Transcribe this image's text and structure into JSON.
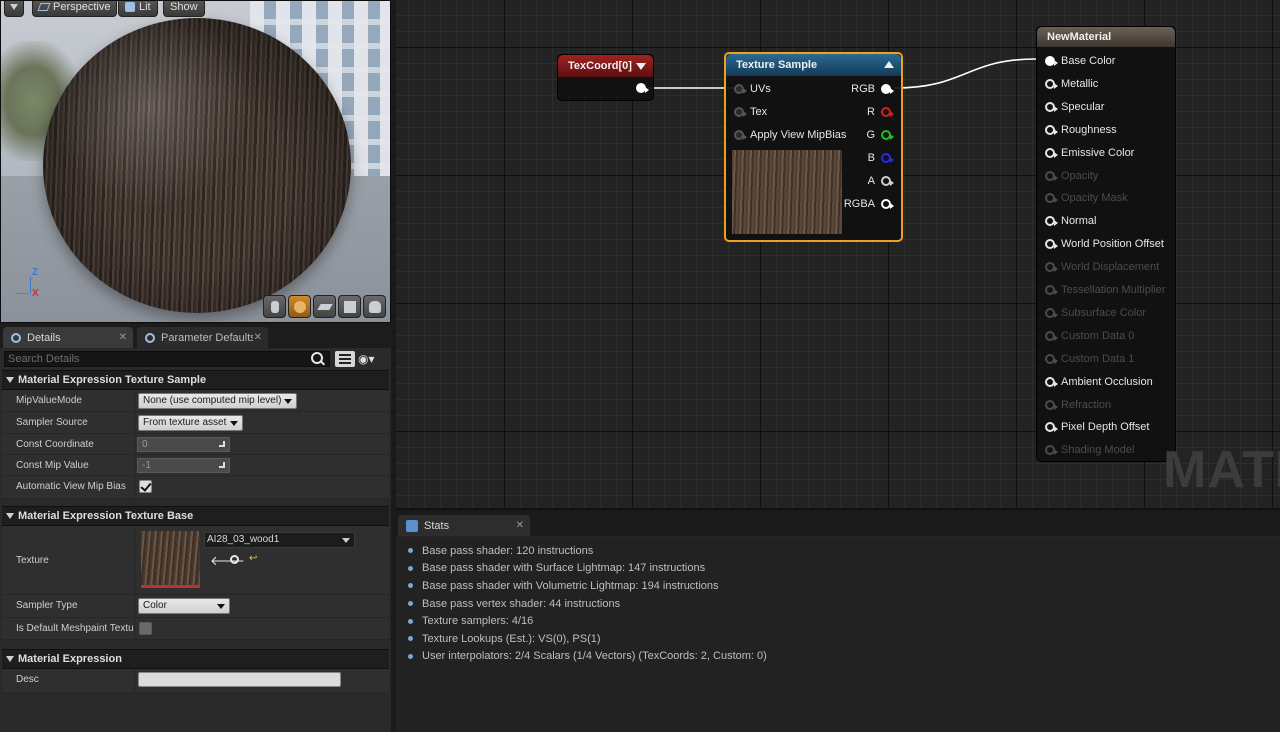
{
  "viewport": {
    "perspective_label": "Perspective",
    "lit_label": "Lit",
    "show_label": "Show",
    "axis_z": "Z",
    "axis_x": "X"
  },
  "details": {
    "tabs": [
      {
        "label": "Details",
        "active": true
      },
      {
        "label": "Parameter Defaults",
        "active": false
      }
    ],
    "search_placeholder": "Search Details",
    "sections": {
      "texture_sample": {
        "title": "Material Expression Texture Sample",
        "props": {
          "mip_value_mode": {
            "label": "MipValueMode",
            "value": "None (use computed mip level)"
          },
          "sampler_source": {
            "label": "Sampler Source",
            "value": "From texture asset"
          },
          "const_coordinate": {
            "label": "Const Coordinate",
            "value": "0"
          },
          "const_mip_value": {
            "label": "Const Mip Value",
            "value": "-1"
          },
          "auto_view_mip_bias": {
            "label": "Automatic View Mip Bias",
            "checked": true
          }
        }
      },
      "texture_base": {
        "title": "Material Expression Texture Base",
        "props": {
          "texture": {
            "label": "Texture",
            "asset": "AI28_03_wood1"
          },
          "sampler_type": {
            "label": "Sampler Type",
            "value": "Color"
          },
          "is_default_meshpaint": {
            "label": "Is Default Meshpaint Texture",
            "checked": false
          }
        }
      },
      "expression": {
        "title": "Material Expression",
        "props": {
          "desc": {
            "label": "Desc",
            "value": ""
          }
        }
      }
    }
  },
  "graph": {
    "watermark": "MATE",
    "texcoord_node": {
      "title": "TexCoord[0]",
      "color": "#7a1a1a"
    },
    "texture_sample_node": {
      "title": "Texture Sample",
      "color": "#1f4f70",
      "highlight": "#f0a020",
      "inputs": [
        "UVs",
        "Tex",
        "Apply View MipBias"
      ],
      "outputs": [
        {
          "label": "RGB",
          "color": "#ffffff"
        },
        {
          "label": "R",
          "color": "#d02020"
        },
        {
          "label": "G",
          "color": "#20c020"
        },
        {
          "label": "B",
          "color": "#2030e0"
        },
        {
          "label": "A",
          "color": "#cfcfcf"
        },
        {
          "label": "RGBA",
          "color": "#ffffff"
        }
      ]
    },
    "material_node": {
      "title": "NewMaterial",
      "pins": [
        {
          "label": "Base Color",
          "enabled": true,
          "connected": true
        },
        {
          "label": "Metallic",
          "enabled": true
        },
        {
          "label": "Specular",
          "enabled": true
        },
        {
          "label": "Roughness",
          "enabled": true
        },
        {
          "label": "Emissive Color",
          "enabled": true
        },
        {
          "label": "Opacity",
          "enabled": false
        },
        {
          "label": "Opacity Mask",
          "enabled": false
        },
        {
          "label": "Normal",
          "enabled": true
        },
        {
          "label": "World Position Offset",
          "enabled": true
        },
        {
          "label": "World Displacement",
          "enabled": false
        },
        {
          "label": "Tessellation Multiplier",
          "enabled": false
        },
        {
          "label": "Subsurface Color",
          "enabled": false
        },
        {
          "label": "Custom Data 0",
          "enabled": false
        },
        {
          "label": "Custom Data 1",
          "enabled": false
        },
        {
          "label": "Ambient Occlusion",
          "enabled": true
        },
        {
          "label": "Refraction",
          "enabled": false
        },
        {
          "label": "Pixel Depth Offset",
          "enabled": true
        },
        {
          "label": "Shading Model",
          "enabled": false
        }
      ]
    }
  },
  "stats": {
    "tab_label": "Stats",
    "lines": [
      "Base pass shader: 120 instructions",
      "Base pass shader with Surface Lightmap: 147 instructions",
      "Base pass shader with Volumetric Lightmap: 194 instructions",
      "Base pass vertex shader: 44 instructions",
      "Texture samplers: 4/16",
      "Texture Lookups (Est.): VS(0), PS(1)",
      "User interpolators: 2/4 Scalars (1/4 Vectors) (TexCoords: 2, Custom: 0)"
    ]
  }
}
